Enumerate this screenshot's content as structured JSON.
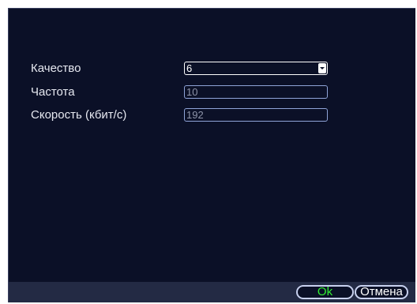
{
  "form": {
    "quality_label": "Качество",
    "quality_value": "6",
    "frequency_label": "Частота",
    "frequency_value": "10",
    "bitrate_label": "Скорость (кбит/с)",
    "bitrate_value": "192"
  },
  "buttons": {
    "ok_label": "Ok",
    "cancel_label": "Отмена"
  },
  "icons": {
    "dropdown": "chevron-down-icon"
  },
  "colors": {
    "background": "#0b1027",
    "ok_text": "#33ee33",
    "field_border": "#8fa4d8"
  }
}
